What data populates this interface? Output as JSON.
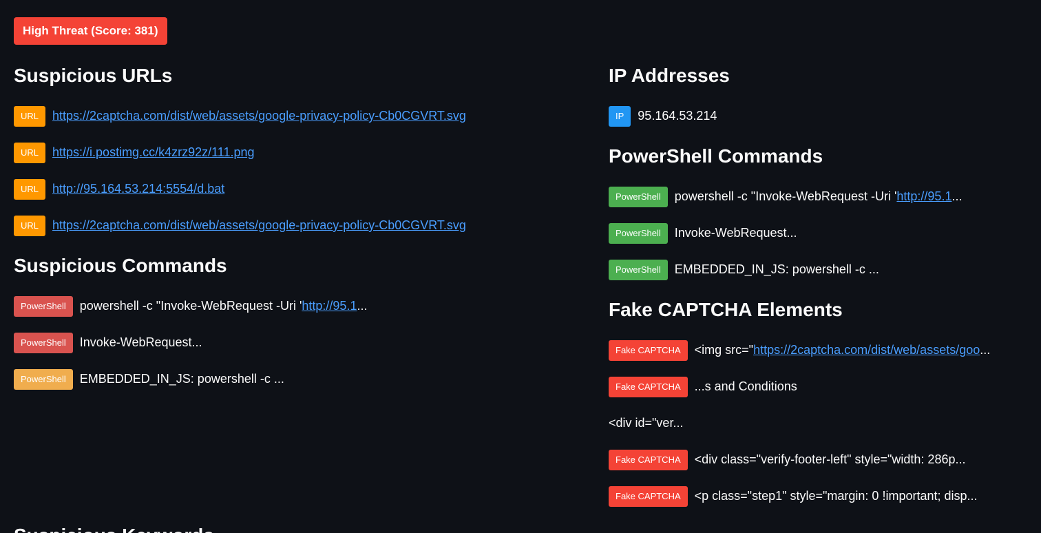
{
  "threat_badge": "High Threat (Score: 381)",
  "suspicious_urls": {
    "title": "Suspicious URLs",
    "items": [
      {
        "tag": "URL",
        "url": "https://2captcha.com/dist/web/assets/google-privacy-policy-Cb0CGVRT.svg"
      },
      {
        "tag": "URL",
        "url": "https://i.postimg.cc/k4zrz92z/111.png"
      },
      {
        "tag": "URL",
        "url": "http://95.164.53.214:5554/d.bat"
      },
      {
        "tag": "URL",
        "url": "https://2captcha.com/dist/web/assets/google-privacy-policy-Cb0CGVRT.svg"
      }
    ]
  },
  "suspicious_commands": {
    "title": "Suspicious Commands",
    "items": [
      {
        "tag": "PowerShell",
        "text": "powershell -c \"Invoke-WebRequest -Uri '",
        "link": "http://95.1",
        "suffix": "..."
      },
      {
        "tag": "PowerShell",
        "text": "Invoke-WebRequest..."
      },
      {
        "tag": "PowerShell",
        "text": "EMBEDDED_IN_JS: powershell -c ..."
      }
    ]
  },
  "ip_addresses": {
    "title": "IP Addresses",
    "items": [
      {
        "tag": "IP",
        "text": "95.164.53.214"
      }
    ]
  },
  "powershell_commands": {
    "title": "PowerShell Commands",
    "items": [
      {
        "tag": "PowerShell",
        "text": "powershell -c \"Invoke-WebRequest -Uri '",
        "link": "http://95.1",
        "suffix": "..."
      },
      {
        "tag": "PowerShell",
        "text": "Invoke-WebRequest..."
      },
      {
        "tag": "PowerShell",
        "text": "EMBEDDED_IN_JS: powershell -c ..."
      }
    ]
  },
  "fake_captcha": {
    "title": "Fake CAPTCHA Elements",
    "items": [
      {
        "tag": "Fake CAPTCHA",
        "text": "<img src=\"",
        "link": "https://2captcha.com/dist/web/assets/goo",
        "suffix": "..."
      },
      {
        "tag": "Fake CAPTCHA",
        "text": "...s and Conditions"
      },
      {
        "tag": "",
        "text": "<div id=\"ver..."
      },
      {
        "tag": "Fake CAPTCHA",
        "text": "<div class=\"verify-footer-left\" style=\"width: 286p..."
      },
      {
        "tag": "Fake CAPTCHA",
        "text": "<p class=\"step1\" style=\"margin: 0 !important; disp..."
      }
    ]
  },
  "bottom_heading": "Suspicious Keywords",
  "colors": {
    "background": "#0e1117",
    "threat": "#f44336",
    "url_tag": "#ff9800",
    "ip_tag": "#2196f3",
    "link": "#4a9eff"
  }
}
